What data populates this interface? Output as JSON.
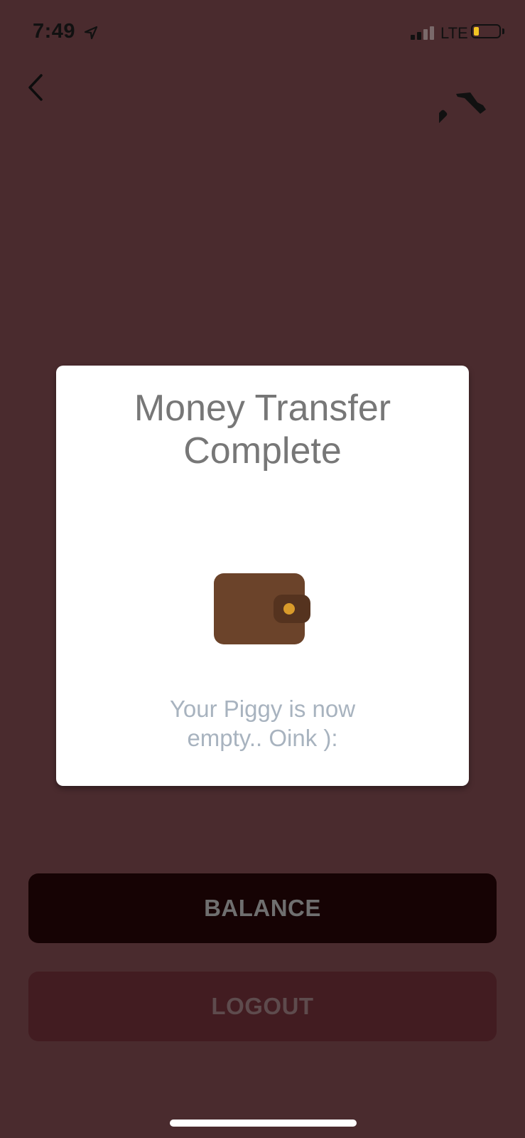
{
  "status_bar": {
    "time": "7:49",
    "carrier": "LTE",
    "icons": [
      "location-arrow-icon",
      "signal-icon",
      "battery-icon"
    ],
    "battery_color": "#f3c623"
  },
  "header": {
    "back_icon": "chevron-left-icon",
    "tool_icon": "hammer-icon"
  },
  "modal": {
    "title": "Money Transfer\nComplete",
    "icon": "wallet-icon",
    "message": "Your Piggy is now\nempty.. Oink ):"
  },
  "buttons": {
    "balance_label": "BALANCE",
    "logout_label": "LOGOUT"
  },
  "colors": {
    "background": "#4a2b2e",
    "balance_button": "#160304",
    "logout_button": "#421c21",
    "wallet_body": "#6b432a",
    "wallet_clasp": "#55331f",
    "wallet_button": "#d99b2b"
  }
}
